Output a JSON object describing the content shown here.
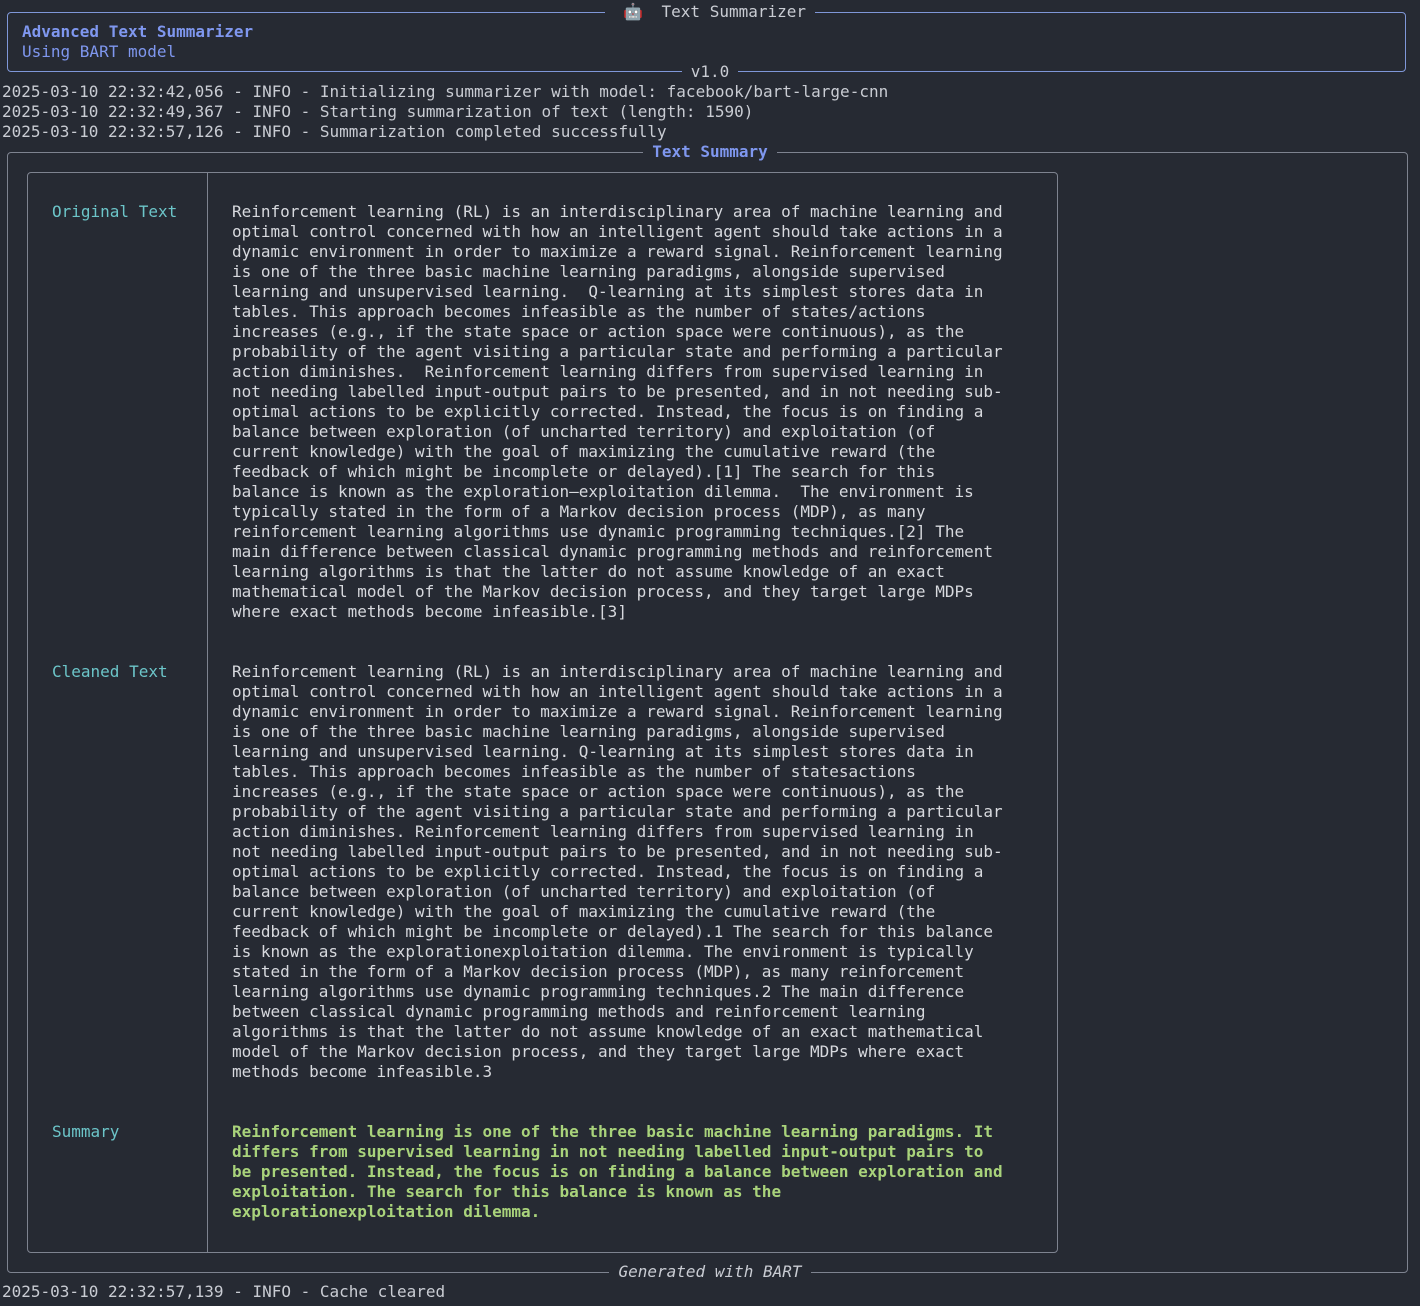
{
  "header": {
    "icon": "robot-icon",
    "title": "Text Summarizer",
    "app_name": "Advanced Text Summarizer",
    "subtitle": "Using BART model",
    "version": "v1.0"
  },
  "logs_before": [
    "2025-03-10 22:32:42,056 - INFO - Initializing summarizer with model: facebook/bart-large-cnn",
    "2025-03-10 22:32:49,367 - INFO - Starting summarization of text (length: 1590)",
    "2025-03-10 22:32:57,126 - INFO - Summarization completed successfully"
  ],
  "panel": {
    "title": "Text Summary",
    "footer": "Generated with BART"
  },
  "rows": [
    {
      "label": "Original Text",
      "text": "Reinforcement learning (RL) is an interdisciplinary area of machine learning and\noptimal control concerned with how an intelligent agent should take actions in a\ndynamic environment in order to maximize a reward signal. Reinforcement learning\nis one of the three basic machine learning paradigms, alongside supervised\nlearning and unsupervised learning.  Q-learning at its simplest stores data in\ntables. This approach becomes infeasible as the number of states/actions\nincreases (e.g., if the state space or action space were continuous), as the\nprobability of the agent visiting a particular state and performing a particular\naction diminishes.  Reinforcement learning differs from supervised learning in\nnot needing labelled input-output pairs to be presented, and in not needing sub-\noptimal actions to be explicitly corrected. Instead, the focus is on finding a\nbalance between exploration (of uncharted territory) and exploitation (of\ncurrent knowledge) with the goal of maximizing the cumulative reward (the\nfeedback of which might be incomplete or delayed).[1] The search for this\nbalance is known as the exploration–exploitation dilemma.  The environment is\ntypically stated in the form of a Markov decision process (MDP), as many\nreinforcement learning algorithms use dynamic programming techniques.[2] The\nmain difference between classical dynamic programming methods and reinforcement\nlearning algorithms is that the latter do not assume knowledge of an exact\nmathematical model of the Markov decision process, and they target large MDPs\nwhere exact methods become infeasible.[3]"
    },
    {
      "label": "Cleaned Text",
      "text": "Reinforcement learning (RL) is an interdisciplinary area of machine learning and\noptimal control concerned with how an intelligent agent should take actions in a\ndynamic environment in order to maximize a reward signal. Reinforcement learning\nis one of the three basic machine learning paradigms, alongside supervised\nlearning and unsupervised learning. Q-learning at its simplest stores data in\ntables. This approach becomes infeasible as the number of statesactions\nincreases (e.g., if the state space or action space were continuous), as the\nprobability of the agent visiting a particular state and performing a particular\naction diminishes. Reinforcement learning differs from supervised learning in\nnot needing labelled input-output pairs to be presented, and in not needing sub-\noptimal actions to be explicitly corrected. Instead, the focus is on finding a\nbalance between exploration (of uncharted territory) and exploitation (of\ncurrent knowledge) with the goal of maximizing the cumulative reward (the\nfeedback of which might be incomplete or delayed).1 The search for this balance\nis known as the explorationexploitation dilemma. The environment is typically\nstated in the form of a Markov decision process (MDP), as many reinforcement\nlearning algorithms use dynamic programming techniques.2 The main difference\nbetween classical dynamic programming methods and reinforcement learning\nalgorithms is that the latter do not assume knowledge of an exact mathematical\nmodel of the Markov decision process, and they target large MDPs where exact\nmethods become infeasible.3"
    },
    {
      "label": "Summary",
      "text": "Reinforcement learning is one of the three basic machine learning paradigms. It\ndiffers from supervised learning in not needing labelled input-output pairs to\nbe presented. Instead, the focus is on finding a balance between exploration and\nexploitation. The search for this balance is known as the\nexplorationexploitation dilemma."
    }
  ],
  "logs_after": [
    "2025-03-10 22:32:57,139 - INFO - Cache cleared"
  ],
  "colors": {
    "background": "#262a33",
    "accent": "#7f97ef",
    "label": "#6cc5c9",
    "summary": "#a9d37b"
  }
}
